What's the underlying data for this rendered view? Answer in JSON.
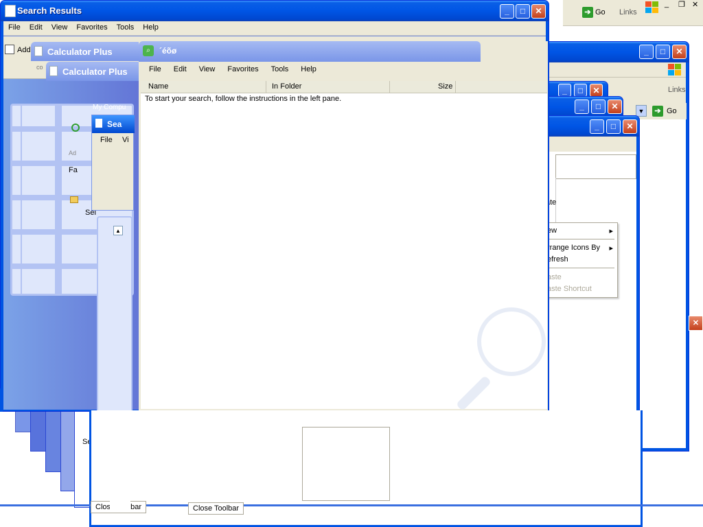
{
  "main_window": {
    "title": "Search Results",
    "menu": [
      "File",
      "Edit",
      "View",
      "Favorites",
      "Tools",
      "Help"
    ],
    "address_fragment": "Add",
    "controls": {
      "minimize": "_",
      "maximize": "□",
      "close": "×"
    }
  },
  "calc_window_1": {
    "title": "Calculator Plus"
  },
  "calc_window_2": {
    "title": "Calculator Plus"
  },
  "search_sub_window": {
    "title": "Sea",
    "menu_file": "File",
    "menu_vi": "Vi"
  },
  "sidebar_fragments": {
    "sei": "Sei",
    "se": "Se",
    "fa": "Fa",
    "ad": "Ad",
    "ma": "My Compu",
    "co": "co"
  },
  "inner_window": {
    "title": "´éõø",
    "menu": [
      "File",
      "Edit",
      "View",
      "Favorites",
      "Tools",
      "Help"
    ],
    "columns": {
      "name": "Name",
      "in_folder": "In Folder",
      "size": "Size"
    },
    "message": "To start your search, follow the instructions in the left pane."
  },
  "right_toolbar": {
    "go": "Go",
    "links": "Links",
    "go2": "Go",
    "links2": "Links"
  },
  "context_menu": {
    "items": [
      {
        "label": "ew",
        "submenu": true,
        "enabled": true
      },
      {
        "label": "rrange Icons By",
        "submenu": true,
        "enabled": true
      },
      {
        "label": "efresh",
        "submenu": false,
        "enabled": true
      },
      {
        "label": "aste",
        "submenu": false,
        "enabled": false
      },
      {
        "label": "aste Shortcut",
        "submenu": false,
        "enabled": false
      }
    ],
    "fragment_ate": "ate"
  },
  "toolbar_buttons": {
    "close_toolbar_1": "Close Toolbar",
    "close_toolbar_2": "Close Toolbar"
  },
  "colors": {
    "xp_blue": "#0054e3",
    "title_inactive": "#7a96e8",
    "close_red": "#d8502a"
  }
}
